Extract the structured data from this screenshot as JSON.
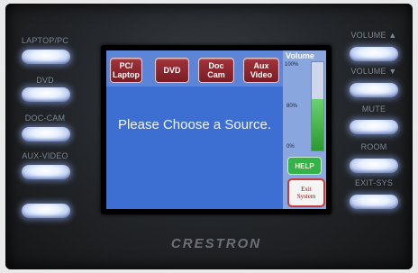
{
  "left_buttons": [
    {
      "label": "LAPTOP/PC"
    },
    {
      "label": "DVD"
    },
    {
      "label": "DOC-CAM"
    },
    {
      "label": "AUX-VIDEO"
    },
    {
      "label": ""
    }
  ],
  "right_buttons": [
    {
      "label": "VOLUME ▲"
    },
    {
      "label": "VOLUME ▼"
    },
    {
      "label": "MUTE"
    },
    {
      "label": "ROOM"
    },
    {
      "label": "EXIT-SYS"
    }
  ],
  "screen": {
    "sources": [
      {
        "label": "PC/\nLaptop"
      },
      {
        "label": "DVD"
      },
      {
        "label": "Doc\nCam"
      },
      {
        "label": "Aux\nVideo"
      }
    ],
    "prompt": "Please Choose a Source.",
    "volume": {
      "title": "Volume",
      "marks": [
        "100%",
        "80%",
        "0%"
      ],
      "level_percent": 58
    },
    "help_label": "HELP",
    "exit_label": "Exit\nSystem"
  },
  "brand": "CRESTRON"
}
